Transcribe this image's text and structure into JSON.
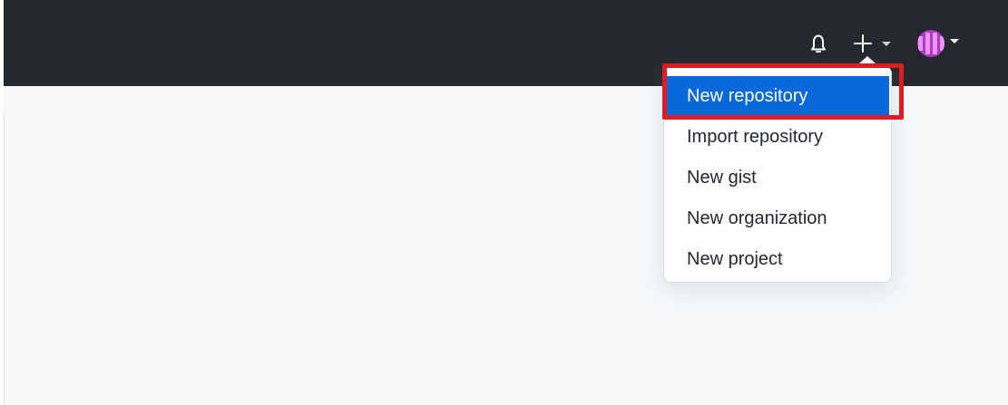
{
  "header": {
    "notifications_icon": "bell-icon",
    "create_icon": "plus-icon",
    "profile_icon": "avatar"
  },
  "create_menu": {
    "items": [
      {
        "label": "New repository",
        "active": true
      },
      {
        "label": "Import repository",
        "active": false
      },
      {
        "label": "New gist",
        "active": false
      },
      {
        "label": "New organization",
        "active": false
      },
      {
        "label": "New project",
        "active": false
      }
    ]
  },
  "colors": {
    "header_background": "#24292f",
    "page_background": "#f6f8fa",
    "active_item": "#0969da",
    "highlight_outline": "#e01b24"
  }
}
